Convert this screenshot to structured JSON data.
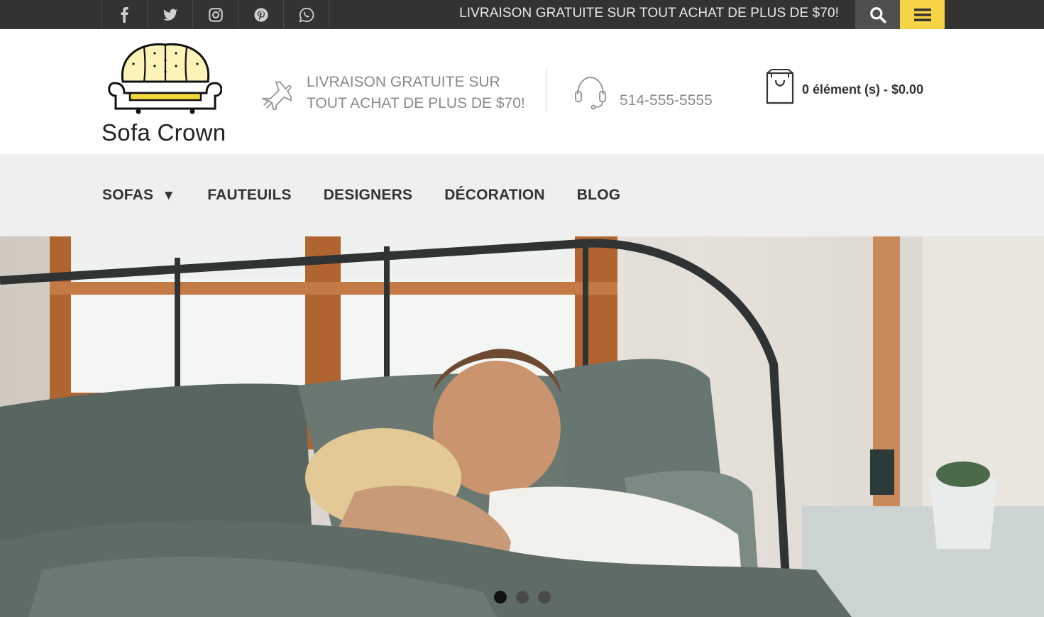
{
  "topbar": {
    "social": [
      {
        "name": "facebook-icon"
      },
      {
        "name": "twitter-icon"
      },
      {
        "name": "instagram-icon"
      },
      {
        "name": "pinterest-icon"
      },
      {
        "name": "whatsapp-icon"
      }
    ],
    "message": "LIVRAISON GRATUITE SUR TOUT ACHAT DE PLUS DE $70!",
    "search_icon": "search-icon",
    "menu_icon": "hamburger-menu-icon"
  },
  "header": {
    "logo_text": "Sofa Crown",
    "shipping_line1": "LIVRAISON GRATUITE SUR",
    "shipping_line2": "TOUT ACHAT DE PLUS DE $70!",
    "phone": "514-555-5555",
    "cart": "0 élément (s) - $0.00"
  },
  "nav": {
    "items": [
      {
        "label": "SOFAS",
        "caret": "▼"
      },
      {
        "label": "FAUTEUILS"
      },
      {
        "label": "DESIGNERS"
      },
      {
        "label": "DÉCORATION"
      },
      {
        "label": "BLOG"
      }
    ]
  },
  "hero": {
    "slides": 3,
    "active_slide": 1
  },
  "colors": {
    "topbar_bg": "#333333",
    "accent_yellow": "#f7d445",
    "nav_bg": "#efefef"
  }
}
